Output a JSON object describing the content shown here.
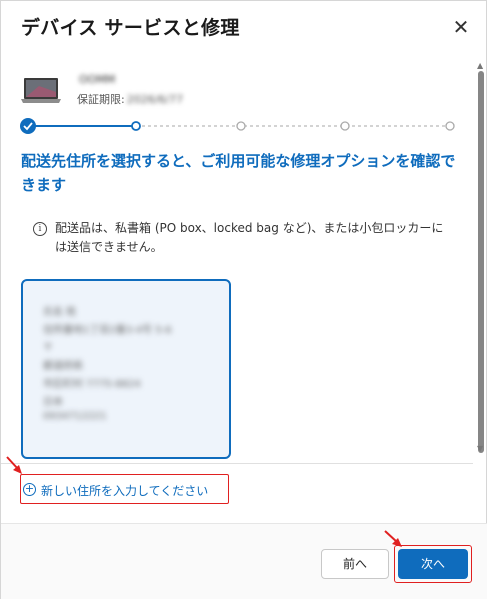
{
  "dialog": {
    "title": "デバイス サービスと修理",
    "close_symbol": "✕"
  },
  "device": {
    "name": "OOMM",
    "warranty_label": "保証期限:",
    "warranty_value": "2026/6/77"
  },
  "progress": {
    "total_steps": 5,
    "current_step": 1
  },
  "heading": "配送先住所を選択すると、ご利用可能な修理オプションを確認できます",
  "notice": {
    "icon": "info-icon",
    "text": "配送品は、私書箱 (PO box、locked bag など)、または小包ロッカーには送信できません。"
  },
  "address": {
    "lines": [
      "氏名 姓",
      "住所番地1丁目2番3-4号 5-6",
      "〒",
      "都道府県",
      "市区町村 7775-8824",
      "日本",
      "0934712221"
    ]
  },
  "new_address": {
    "icon": "plus-circle-icon",
    "label": "新しい住所を入力してください"
  },
  "buttons": {
    "prev": "前へ",
    "next": "次へ"
  },
  "colors": {
    "accent": "#0f6cbd",
    "annotation": "#e02020"
  }
}
